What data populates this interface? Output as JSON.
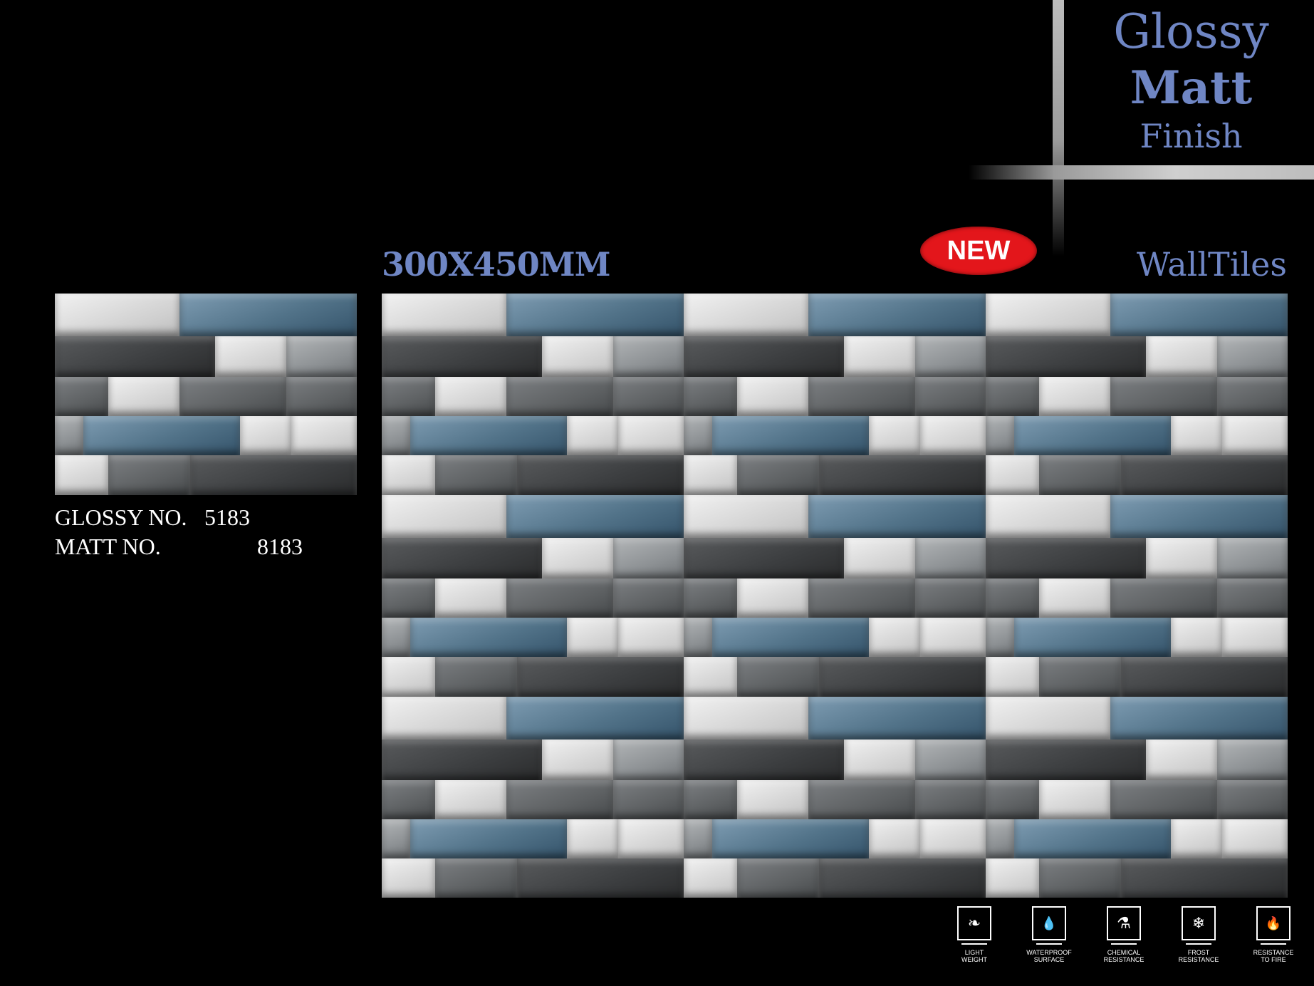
{
  "brand": {
    "line1": "Glossy",
    "line2": "Matt",
    "line3": "Finish"
  },
  "size_label": "300X450MM",
  "badge": "NEW",
  "category": "WallTiles",
  "codes": [
    {
      "label": "GLOSSY NO.",
      "value": "5183"
    },
    {
      "label": "MATT NO.",
      "value": "8183"
    }
  ],
  "features": [
    {
      "icon": "feather-icon",
      "glyph": "❧",
      "line1": "LIGHT",
      "line2": "WEIGHT"
    },
    {
      "icon": "water-drop-icon",
      "glyph": "💧",
      "line1": "WATERPROOF",
      "line2": "SURFACE"
    },
    {
      "icon": "flask-icon",
      "glyph": "⚗",
      "line1": "CHEMICAL",
      "line2": "RESISTANCE"
    },
    {
      "icon": "snowflake-icon",
      "glyph": "❄",
      "line1": "FROST",
      "line2": "RESISTANCE"
    },
    {
      "icon": "flame-icon",
      "glyph": "🔥",
      "line1": "RESISTANCE",
      "line2": "TO FIRE"
    }
  ],
  "colors": {
    "background": "#000000",
    "accent_text": "#6f86c4",
    "badge": "#e3161b"
  }
}
